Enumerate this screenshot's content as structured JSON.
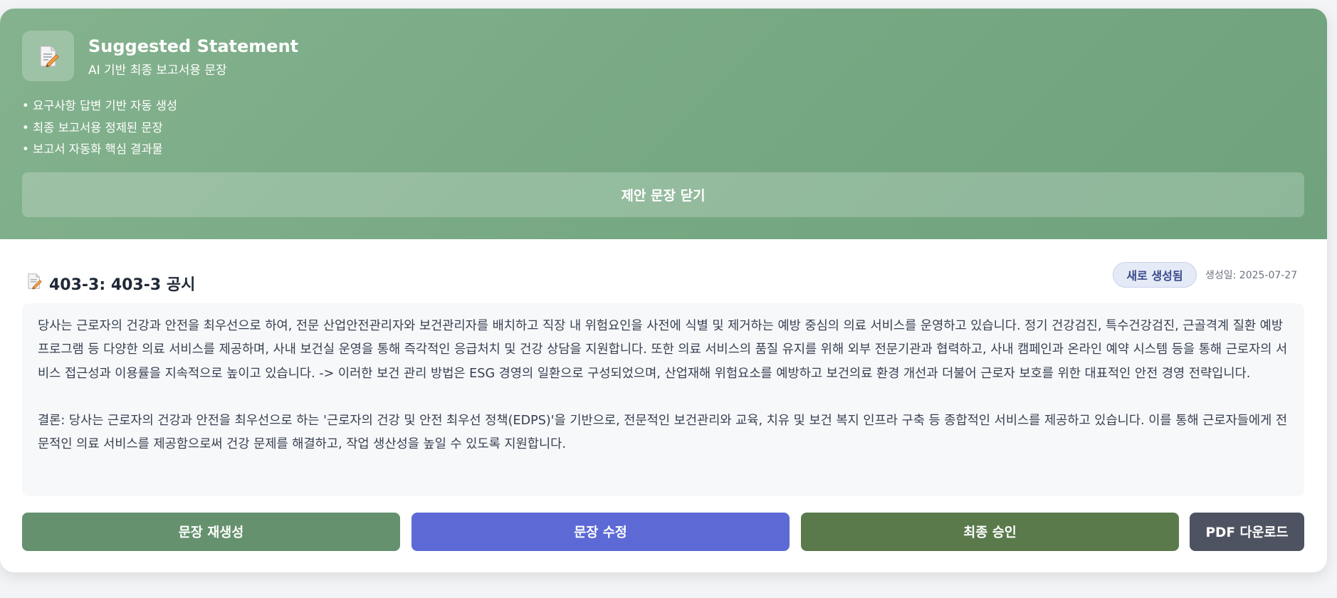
{
  "header": {
    "title": "Suggested Statement",
    "subtitle": "AI 기반 최종 보고서용 문장",
    "icon": "document-edit-icon",
    "features": [
      "• 요구사항 답변 기반 자동 생성",
      "• 최종 보고서용 정제된 문장",
      "• 보고서 자동화 핵심 결과물"
    ],
    "close_label": "제안 문장 닫기"
  },
  "statement": {
    "title": "403-3: 403-3 공시",
    "icon": "document-edit-icon",
    "status": "새로 생성됨",
    "created": "생성일: 2025-07-27",
    "paragraphs": [
      "당사는 근로자의 건강과 안전을 최우선으로 하여, 전문 산업안전관리자와 보건관리자를 배치하고 직장 내 위험요인을 사전에 식별 및 제거하는 예방 중심의 의료 서비스를 운영하고 있습니다. 정기 건강검진, 특수건강검진, 근골격계 질환 예방 프로그램 등 다양한 의료 서비스를 제공하며, 사내 보건실 운영을 통해 즉각적인 응급처치 및 건강 상담을 지원합니다. 또한 의료 서비스의 품질 유지를 위해 외부 전문기관과 협력하고, 사내 캠페인과 온라인 예약 시스템 등을 통해 근로자의 서비스 접근성과 이용률을 지속적으로 높이고 있습니다. -> 이러한 보건 관리 방법은 ESG 경영의 일환으로 구성되었으며, 산업재해 위험요소를 예방하고 보건의료 환경 개선과 더불어 근로자 보호를 위한 대표적인 안전 경영 전략입니다.",
      "결론: 당사는 근로자의 건강과 안전을 최우선으로 하는 '근로자의 건강 및 안전 최우선 정책(EDPS)'을 기반으로, 전문적인 보건관리와 교육, 치유 및 보건 복지 인프라 구축 등 종합적인 서비스를 제공하고 있습니다. 이를 통해 근로자들에게 전문적인 의료 서비스를 제공함으로써 건강 문제를 해결하고, 작업 생산성을 높일 수 있도록 지원합니다."
    ]
  },
  "actions": {
    "regenerate": "문장 재생성",
    "edit": "문장 수정",
    "approve": "최종 승인",
    "pdf": "PDF 다운로드"
  },
  "colors": {
    "header_green": "#7aab86",
    "regenerate": "#65916f",
    "edit": "#5d6ad6",
    "approve": "#5a7a4c",
    "pdf": "#4e5361",
    "badge_bg": "#e5eaf7",
    "badge_text": "#3a4a8a"
  }
}
